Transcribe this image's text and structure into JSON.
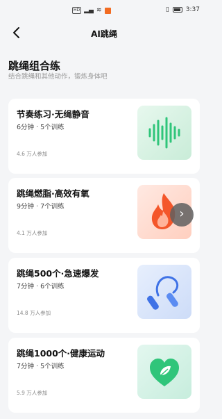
{
  "status_bar": {
    "left": "HD",
    "time": "3:37"
  },
  "nav": {
    "title": "AI跳绳"
  },
  "section": {
    "title": "跳绳组合练",
    "subtitle": "结合跳绳和其他动作，锻炼身体吧"
  },
  "cards": [
    {
      "title": "节奏练习·无绳静音",
      "meta": "6分钟 · 5个训练",
      "count": "4.6 万人参加",
      "icon": "sound-wave-icon"
    },
    {
      "title": "跳绳燃脂·高效有氧",
      "meta": "9分钟 · 7个训练",
      "count": "4.1 万人参加",
      "icon": "flame-icon"
    },
    {
      "title": "跳绳500个·急速爆发",
      "meta": "7分钟 · 6个训练",
      "count": "14.8 万人参加",
      "icon": "jump-rope-icon"
    },
    {
      "title": "跳绳1000个·健康运动",
      "meta": "7分钟 · 5个训练",
      "count": "5.9 万人参加",
      "icon": "leaf-heart-icon"
    }
  ],
  "colors": {
    "accent_green": "#2fc57a",
    "accent_red": "#f4562a",
    "accent_blue": "#3f72e6"
  }
}
